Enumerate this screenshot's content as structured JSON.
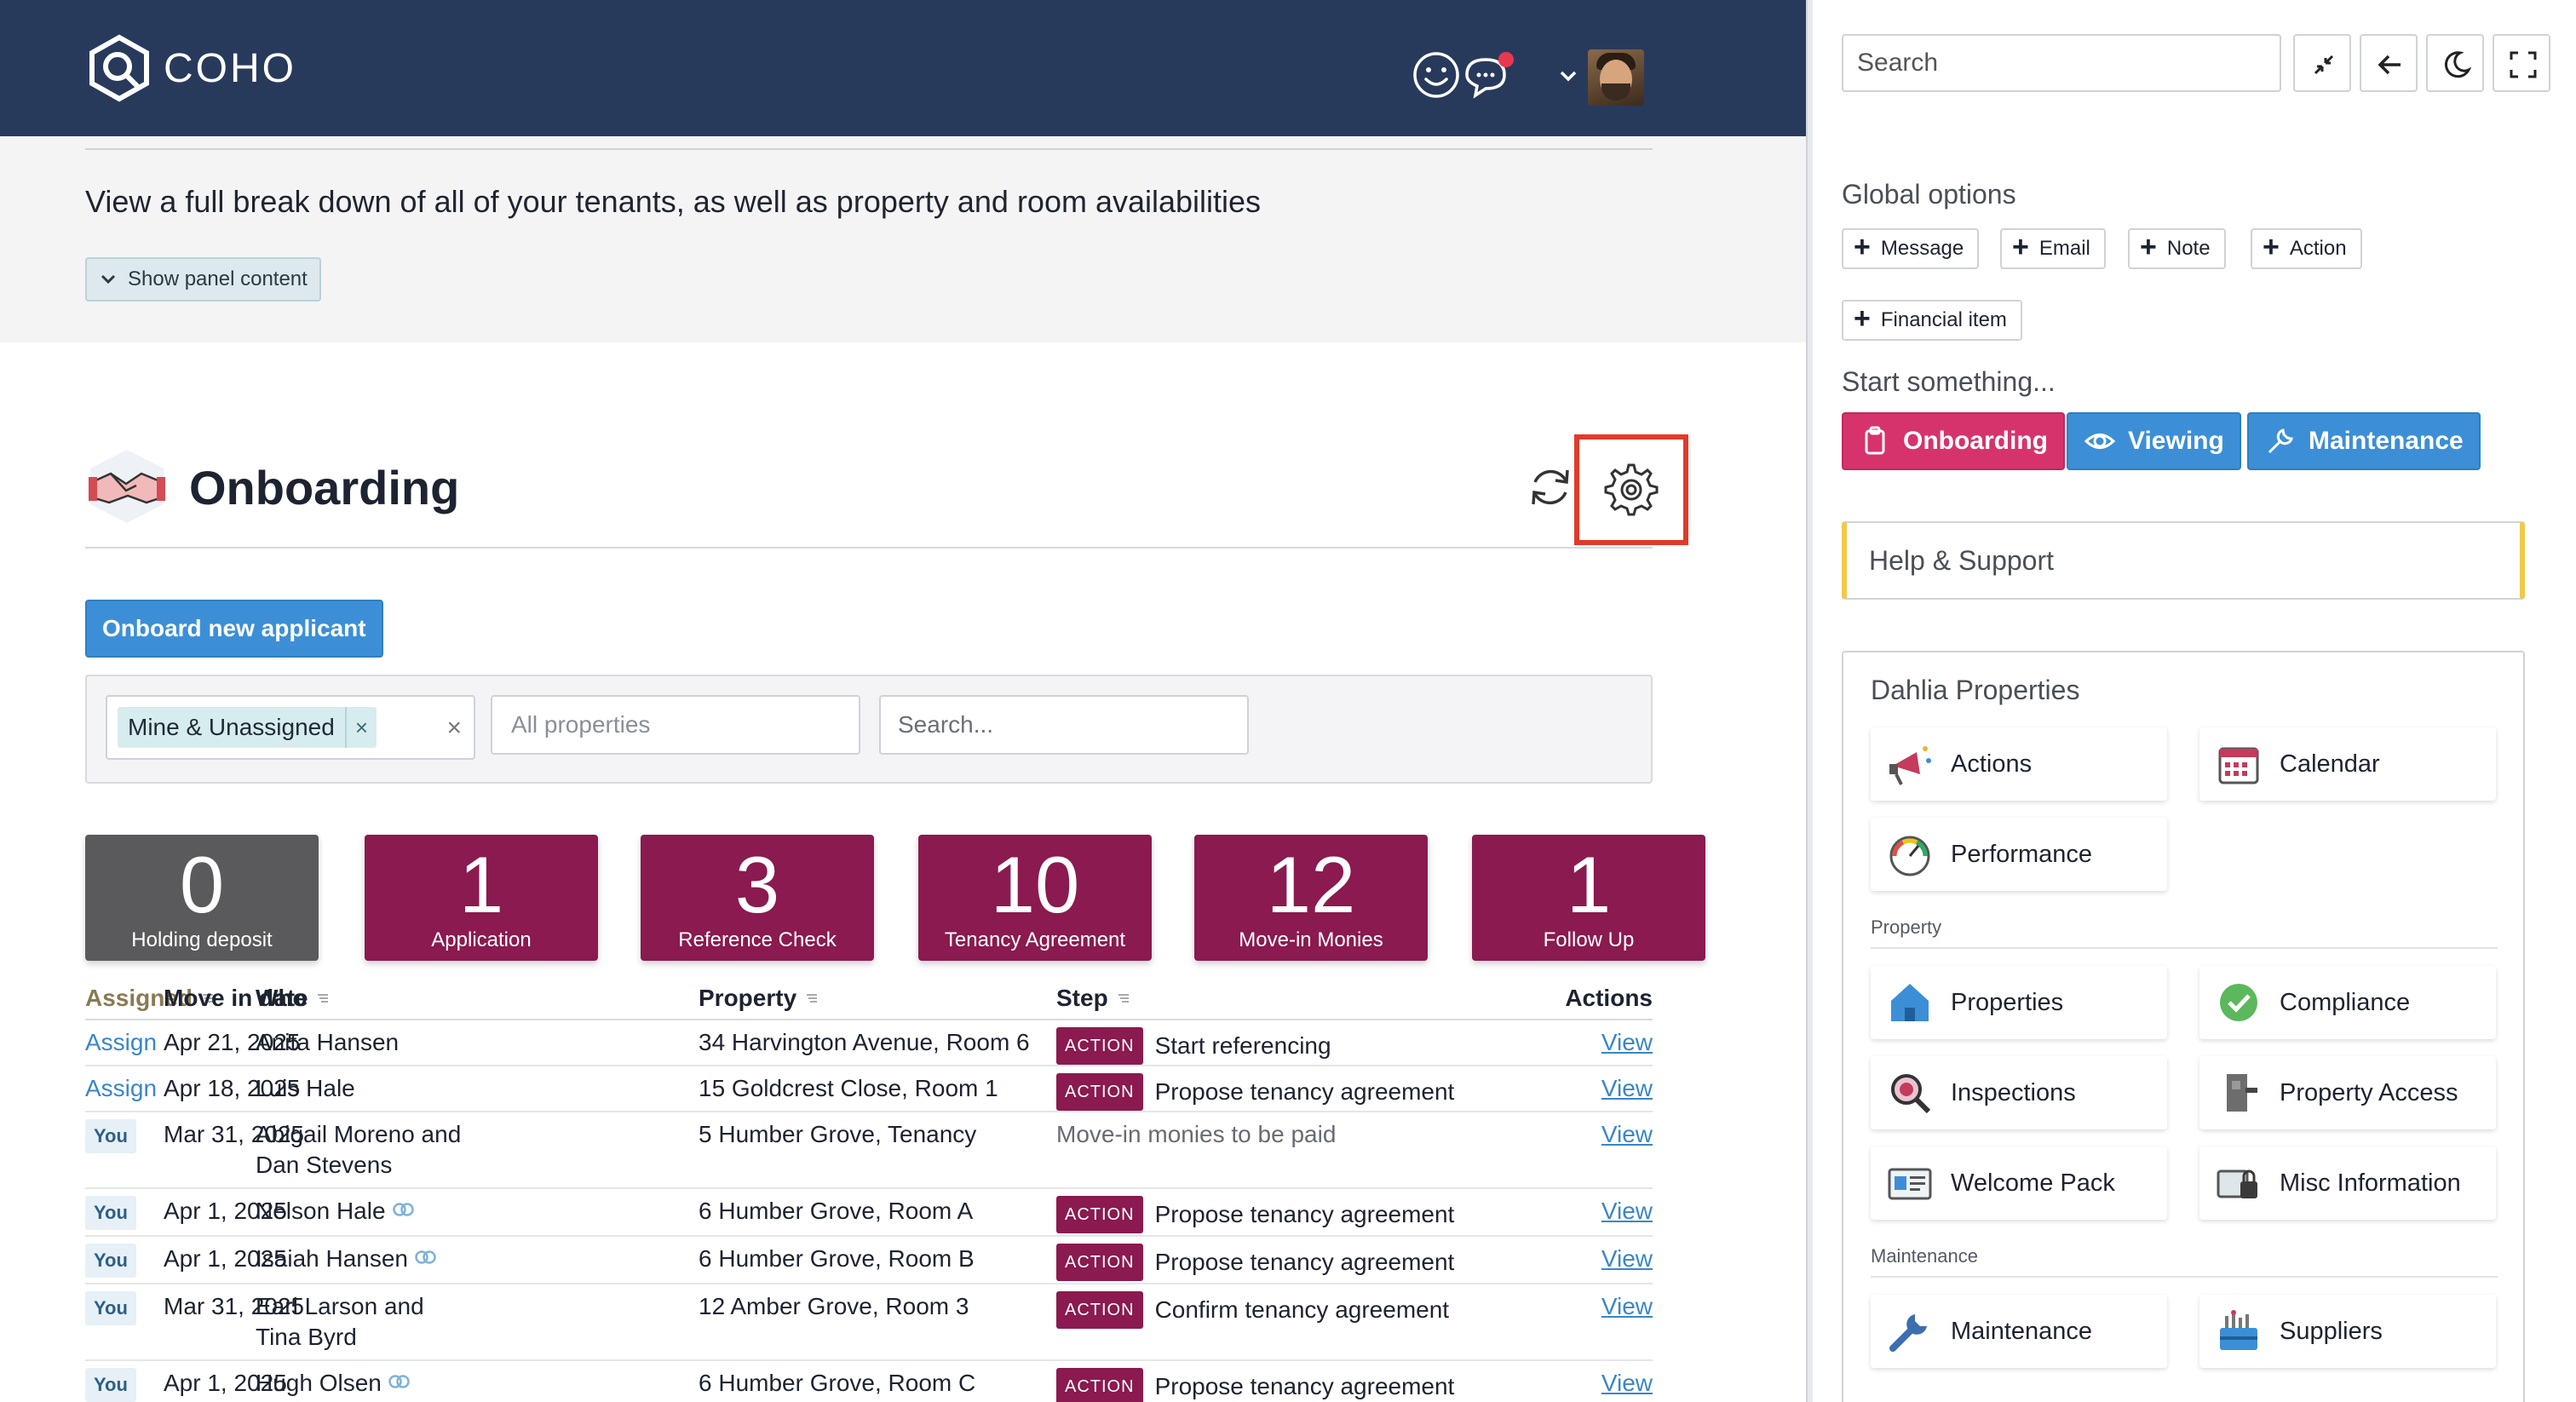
{
  "app": {
    "brand": "COHO"
  },
  "panel": {
    "description": "View a full break down of all of your tenants, as well as property and room availabilities",
    "show_panel_label": "Show panel content"
  },
  "onboarding": {
    "title": "Onboarding",
    "new_button_label": "Onboard new applicant",
    "filters": {
      "mine_tag": "Mine & Unassigned",
      "tag_remove": "×",
      "clear": "×",
      "properties_placeholder": "All properties",
      "search_placeholder": "Search..."
    },
    "stats": [
      {
        "count": "0",
        "label": "Holding deposit",
        "tone": "grey"
      },
      {
        "count": "1",
        "label": "Application",
        "tone": "maroon"
      },
      {
        "count": "3",
        "label": "Reference Check",
        "tone": "maroon"
      },
      {
        "count": "10",
        "label": "Tenancy Agreement",
        "tone": "maroon"
      },
      {
        "count": "12",
        "label": "Move-in Monies",
        "tone": "maroon"
      },
      {
        "count": "1",
        "label": "Follow Up",
        "tone": "maroon"
      }
    ],
    "table": {
      "headers": {
        "assigned": "Assigned",
        "move_in": "Move in date",
        "who": "Who",
        "property": "Property",
        "step": "Step",
        "actions": "Actions"
      },
      "action_badge": "ACTION",
      "view_label": "View",
      "rows": [
        {
          "assigned": "Assign",
          "assigned_type": "link",
          "move_in": "Apr 21, 2025",
          "who": [
            "Anita Hansen"
          ],
          "linked": false,
          "property": "34 Harvington Avenue, Room 6",
          "has_action": true,
          "step": "Start referencing"
        },
        {
          "assigned": "Assign",
          "assigned_type": "link",
          "move_in": "Apr 18, 2025",
          "who": [
            "Luis Hale"
          ],
          "linked": false,
          "property": "15 Goldcrest Close, Room 1",
          "has_action": true,
          "step": "Propose tenancy agreement"
        },
        {
          "assigned": "You",
          "assigned_type": "badge",
          "move_in": "Mar 31, 2025",
          "who": [
            "Abigail Moreno and",
            "Dan Stevens"
          ],
          "linked": false,
          "property": "5 Humber Grove, Tenancy",
          "has_action": false,
          "step": "Move-in monies to be paid"
        },
        {
          "assigned": "You",
          "assigned_type": "badge",
          "move_in": "Apr 1, 2025",
          "who": [
            "Nelson Hale"
          ],
          "linked": true,
          "property": "6 Humber Grove, Room A",
          "has_action": true,
          "step": "Propose tenancy agreement"
        },
        {
          "assigned": "You",
          "assigned_type": "badge",
          "move_in": "Apr 1, 2025",
          "who": [
            "Isaiah Hansen"
          ],
          "linked": true,
          "property": "6 Humber Grove, Room B",
          "has_action": true,
          "step": "Propose tenancy agreement"
        },
        {
          "assigned": "You",
          "assigned_type": "badge",
          "move_in": "Mar 31, 2025",
          "who": [
            "Earl Larson and",
            "Tina Byrd"
          ],
          "linked": false,
          "property": "12 Amber Grove, Room 3",
          "has_action": true,
          "step": "Confirm tenancy agreement"
        },
        {
          "assigned": "You",
          "assigned_type": "badge",
          "move_in": "Apr 1, 2025",
          "who": [
            "Hugh Olsen"
          ],
          "linked": true,
          "property": "6 Humber Grove, Room C",
          "has_action": true,
          "step": "Propose tenancy agreement"
        }
      ]
    }
  },
  "sidebar": {
    "search_placeholder": "Search",
    "tools": [
      "collapse-icon",
      "back-arrow-icon",
      "moon-icon",
      "fullscreen-icon"
    ],
    "global_options_title": "Global options",
    "global_options": [
      "Message",
      "Email",
      "Note",
      "Action",
      "Financial item"
    ],
    "start_title": "Start something...",
    "start": {
      "onboarding": "Onboarding",
      "viewing": "Viewing",
      "maintenance": "Maintenance"
    },
    "help_label": "Help & Support",
    "dahlia": {
      "title": "Dahlia Properties",
      "top": [
        {
          "label": "Actions",
          "icon": "megaphone-icon"
        },
        {
          "label": "Calendar",
          "icon": "calendar-icon"
        },
        {
          "label": "Performance",
          "icon": "gauge-icon"
        }
      ],
      "property_group": "Property",
      "property": [
        {
          "label": "Properties",
          "icon": "house-icon"
        },
        {
          "label": "Compliance",
          "icon": "checkmark-icon"
        },
        {
          "label": "Inspections",
          "icon": "magnifier-icon"
        },
        {
          "label": "Property Access",
          "icon": "door-icon"
        },
        {
          "label": "Welcome Pack",
          "icon": "id-card-icon"
        },
        {
          "label": "Misc Information",
          "icon": "lock-icon"
        }
      ],
      "maintenance_group": "Maintenance",
      "maintenance": [
        {
          "label": "Maintenance",
          "icon": "wrench-icon"
        },
        {
          "label": "Suppliers",
          "icon": "toolbox-icon"
        }
      ]
    }
  },
  "colors": {
    "topbar": "#283a5c",
    "maroon": "#8a1a4f",
    "accent_blue": "#3c8fd6",
    "pink": "#d6336c",
    "highlight_red": "#e23a2a"
  }
}
